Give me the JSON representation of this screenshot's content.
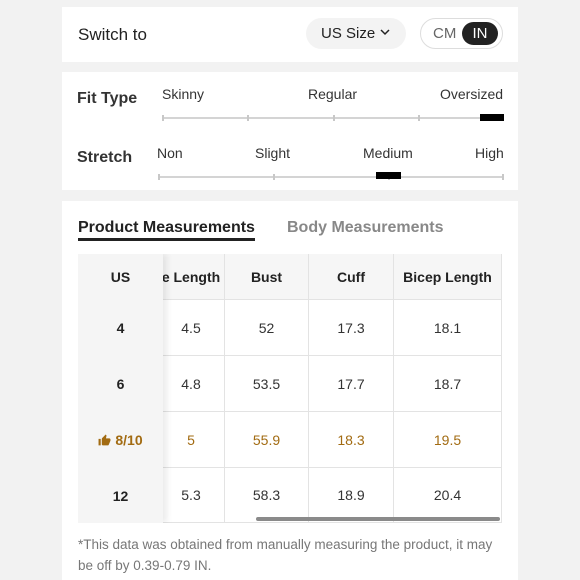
{
  "switch": {
    "label": "Switch to",
    "size_select": "US Size",
    "unit_options": [
      "CM",
      "IN"
    ],
    "selected_unit": "IN"
  },
  "fit": {
    "title": "Fit Type",
    "labels": [
      "Skinny",
      "Regular",
      "Oversized"
    ],
    "selected": "Oversized"
  },
  "stretch": {
    "title": "Stretch",
    "labels": [
      "Non",
      "Slight",
      "Medium",
      "High"
    ],
    "selected": "Medium"
  },
  "measurements": {
    "tabs": [
      "Product Measurements",
      "Body Measurements"
    ],
    "active_tab": "Product Measurements",
    "frozen_header": "US",
    "columns": [
      "e Length",
      "Bust",
      "Cuff",
      "Bicep Length"
    ],
    "rows": [
      {
        "size": "4",
        "values": [
          "4.5",
          "52",
          "17.3",
          "18.1"
        ],
        "highlight": false
      },
      {
        "size": "6",
        "values": [
          "4.8",
          "53.5",
          "17.7",
          "18.7"
        ],
        "highlight": false
      },
      {
        "size": "8/10",
        "values": [
          "5",
          "55.9",
          "18.3",
          "19.5"
        ],
        "highlight": true
      },
      {
        "size": "12",
        "values": [
          "5.3",
          "58.3",
          "18.9",
          "20.4"
        ],
        "highlight": false
      }
    ],
    "note": "*This data was obtained from manually measuring the product, it may be off by 0.39-0.79 IN.",
    "highlight_color": "#a26b12"
  }
}
